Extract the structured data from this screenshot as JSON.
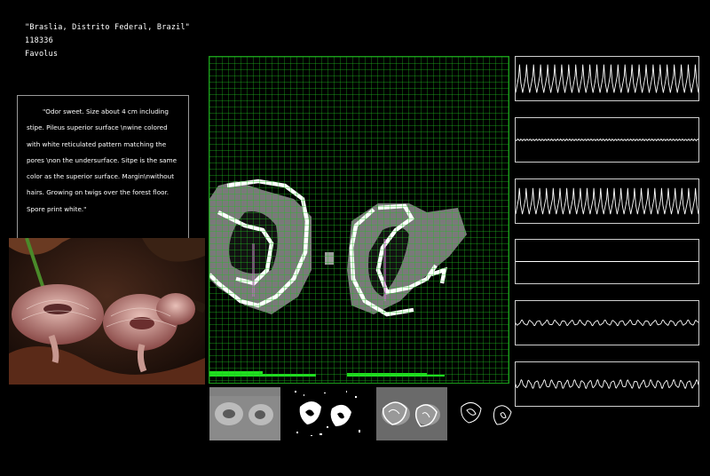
{
  "meta": {
    "location": "\"Braslia, Distrito Federal, Brazil\"",
    "id": "118336",
    "genus": "Favolus"
  },
  "description": "\"Odor sweet. Size about 4 cm including stipe. Pileus superior surface \\nwine colored with white reticulated pattern matching the pores \\non the undersurface. Sitpe is the same color as the superior surface. Margin\\nwithout hairs. Growing on twigs over the forest floor. Spore print white.\"",
  "colors": {
    "grid_line": "#1fbf1f",
    "grid_highlight": "#d070d0",
    "wave": "#ffffff",
    "panel_border": "#cfcfcf"
  },
  "waveforms": [
    {
      "shape": "sawtooth",
      "amplitude": 0.65,
      "cycles": 26
    },
    {
      "shape": "flat",
      "amplitude": 0.04,
      "cycles": 60
    },
    {
      "shape": "sawtooth",
      "amplitude": 0.6,
      "cycles": 27
    },
    {
      "shape": "flat",
      "amplitude": 0.0,
      "cycles": 1
    },
    {
      "shape": "ripple",
      "amplitude": 0.13,
      "cycles": 22
    },
    {
      "shape": "ripple",
      "amplitude": 0.2,
      "cycles": 24
    }
  ],
  "icons": {
    "photo": "mushroom-photo-icon",
    "thumb_gray": "grayscale-thumbnail-icon",
    "thumb_binary": "binary-mask-thumbnail-icon",
    "thumb_edges": "edge-thumbnail-icon",
    "thumb_contour": "contour-outline-icon"
  }
}
